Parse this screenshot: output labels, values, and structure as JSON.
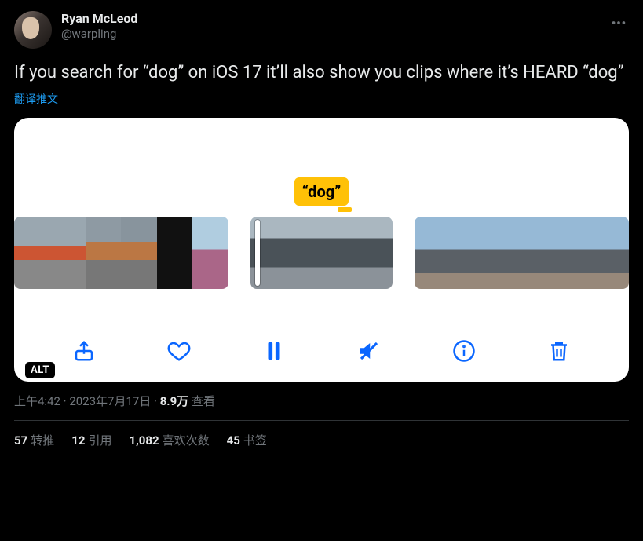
{
  "author": {
    "display_name": "Ryan McLeod",
    "handle": "@warpling"
  },
  "body": "If you search for “dog” on iOS 17 it’ll also show you clips where it’s HEARD “dog”",
  "translate_label": "翻译推文",
  "media": {
    "tag": "“dog”",
    "alt_badge": "ALT"
  },
  "meta": {
    "time": "上午4:42",
    "date": "2023年7月17日",
    "views_count": "8.9万",
    "views_label": "查看"
  },
  "stats": {
    "retweets": {
      "count": "57",
      "label": "转推"
    },
    "quotes": {
      "count": "12",
      "label": "引用"
    },
    "likes": {
      "count": "1,082",
      "label": "喜欢次数"
    },
    "bookmarks": {
      "count": "45",
      "label": "书签"
    }
  }
}
